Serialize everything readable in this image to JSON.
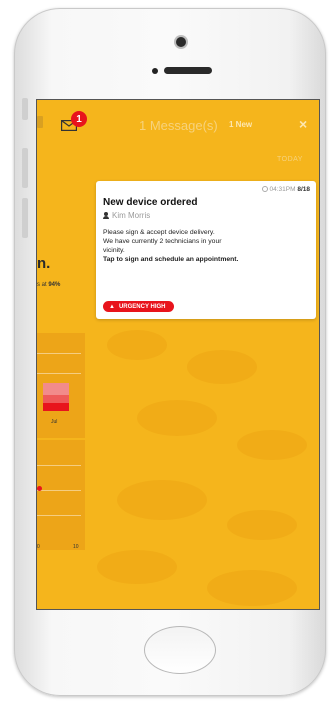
{
  "notification_header": {
    "unread_badge": "1",
    "message_count": "1 Message(s)",
    "new_label": "1 New",
    "close_label": "×",
    "section_label": "TODAY"
  },
  "notification_card": {
    "time": "04:31PM",
    "date": "8/18",
    "title": "New device ordered",
    "author": "Kim Morris",
    "body_lines": [
      "Please sign & accept device delivery.",
      "We have currently 2 technicians in your",
      "vicinity."
    ],
    "call_to_action": "Tap to sign and schedule an appointment.",
    "urgency_label": "URGENCY HIGH"
  },
  "background_dashboard": {
    "heading_fragment": "n.",
    "stat_prefix": "s at",
    "stat_value": "94%",
    "month_label": "Jul",
    "axis_left": "0",
    "axis_right": "10"
  },
  "colors": {
    "screen_background": "#f5b51c",
    "accent_red": "#e8141c"
  }
}
